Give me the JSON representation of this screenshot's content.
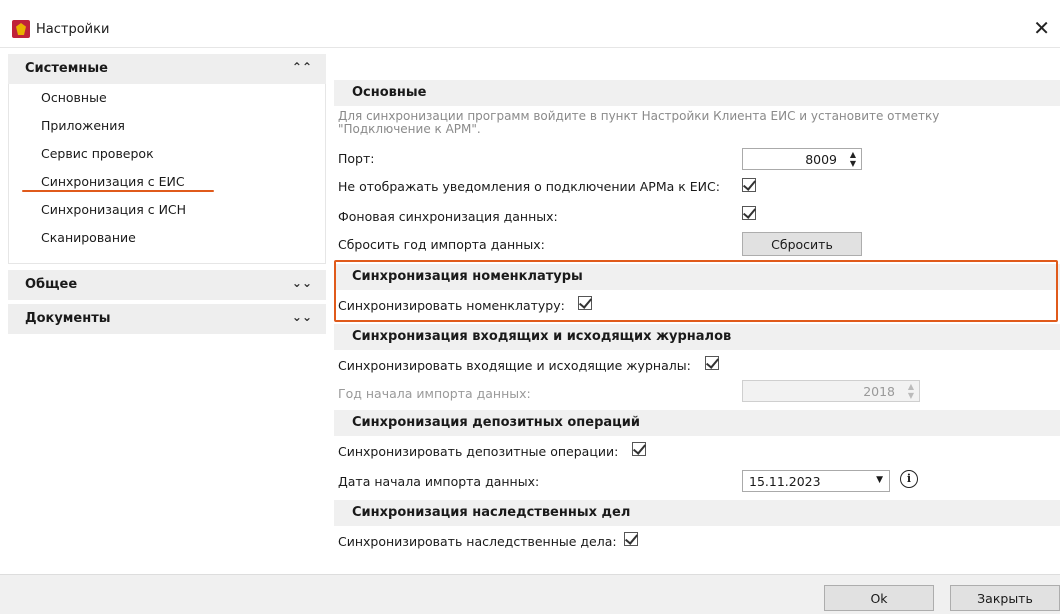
{
  "window": {
    "title": "Настройки"
  },
  "sidebar": {
    "groups": [
      {
        "label": "Системные",
        "chevron": "«"
      },
      {
        "label": "Общее",
        "chevron": "»"
      },
      {
        "label": "Документы",
        "chevron": "»"
      }
    ],
    "items": [
      {
        "label": "Основные"
      },
      {
        "label": "Приложения"
      },
      {
        "label": "Сервис проверок"
      },
      {
        "label": "Синхронизация с ЕИС"
      },
      {
        "label": "Синхронизация с ИСН"
      },
      {
        "label": "Сканирование"
      }
    ]
  },
  "main": {
    "basic": {
      "title": "Основные",
      "description": "Для синхронизации программ войдите в пункт Настройки Клиента ЕИС и установите отметку \"Подключение к АРМ\".",
      "port_label": "Порт:",
      "port_value": "8009",
      "no_notify_label": "Не отображать уведомления о подключении АРМа к ЕИС:",
      "background_sync_label": "Фоновая синхронизация данных:",
      "reset_year_label": "Сбросить год импорта данных:",
      "reset_button": "Сбросить"
    },
    "nomenclature": {
      "title": "Синхронизация номенклатуры",
      "sync_label": "Синхронизировать номенклатуру:"
    },
    "journals": {
      "title": "Синхронизация входящих и исходящих журналов",
      "sync_label": "Синхронизировать входящие и исходящие журналы:",
      "start_year_label": "Год начала импорта данных:",
      "start_year_value": "2018"
    },
    "deposits": {
      "title": "Синхронизация депозитных операций",
      "sync_label": "Синхронизировать депозитные операции:",
      "start_date_label": "Дата начала импорта данных:",
      "start_date_value": "15.11.2023"
    },
    "inheritance": {
      "title": "Синхронизация наследственных дел",
      "sync_label": "Синхронизировать наследственные дела:"
    }
  },
  "footer": {
    "ok": "Ok",
    "close": "Закрыть"
  },
  "colors": {
    "accent": "#e05a1b",
    "app_icon": "#c0223a"
  }
}
